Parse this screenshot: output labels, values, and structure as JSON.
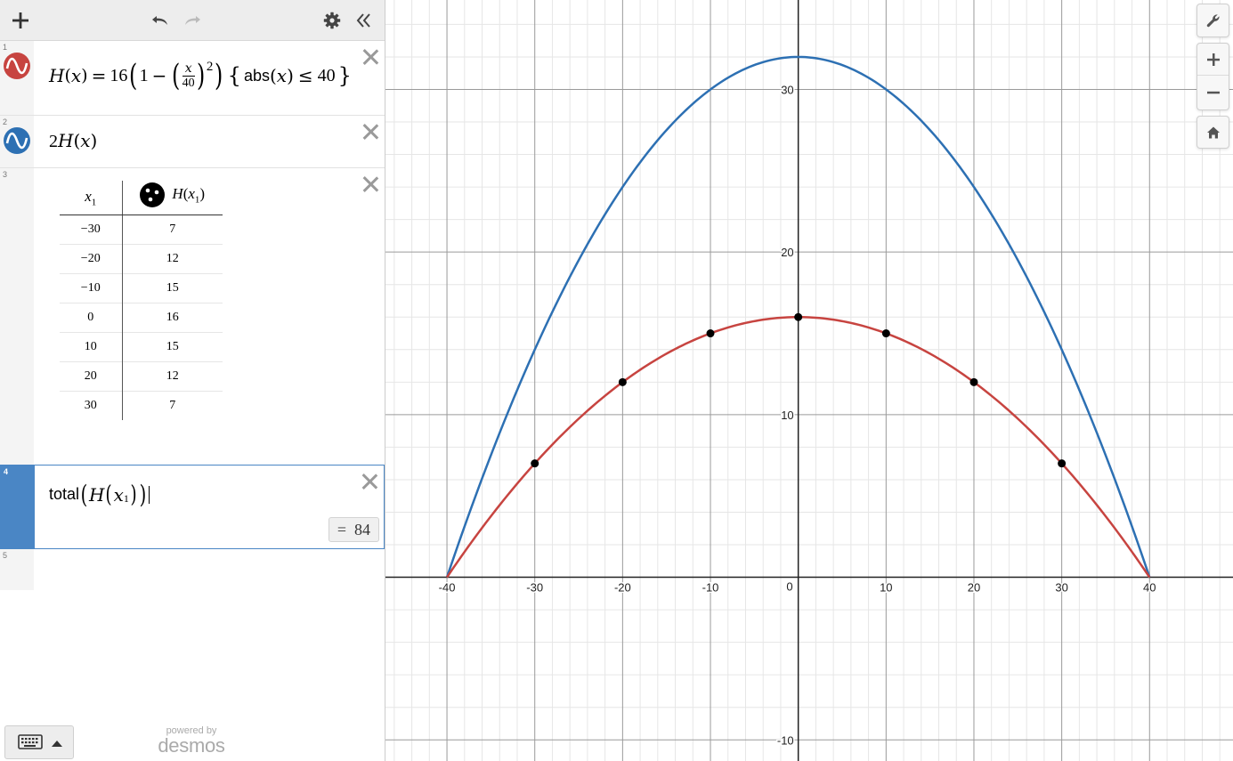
{
  "brand": {
    "powered_by": "powered by",
    "name": "desmos"
  },
  "colors": {
    "red": "#c74440",
    "blue": "#2d70b3",
    "selected": "#4a86c5"
  },
  "toolbar": {
    "add_icon": "plus-icon",
    "undo_icon": "undo-icon",
    "redo_icon": "redo-icon",
    "settings_icon": "gear-icon",
    "collapse_icon": "double-chevron-left-icon"
  },
  "expressions": [
    {
      "number": "1",
      "color": "#c74440",
      "latex": "H(x)=16\\left(1-\\left(\\frac{x}{40}\\right)^2\\right)\\left\\{abs(x)\\le 40\\right\\}",
      "parts": {
        "fn": "H",
        "var": "x",
        "coef": "16",
        "one": "1",
        "frac_num": "x",
        "frac_den": "40",
        "exp": "2",
        "abs": "abs",
        "bound": "40"
      }
    },
    {
      "number": "2",
      "color": "#2d70b3",
      "latex": "2H(x)",
      "parts": {
        "coef": "2",
        "fn": "H",
        "var": "x"
      }
    },
    {
      "number": "3",
      "type": "table",
      "headers": {
        "col1_var": "x",
        "col1_sub": "1",
        "col2_fn": "H",
        "col2_var": "x",
        "col2_sub": "1"
      },
      "rows": [
        [
          "−30",
          "7"
        ],
        [
          "−20",
          "12"
        ],
        [
          "−10",
          "15"
        ],
        [
          "0",
          "16"
        ],
        [
          "10",
          "15"
        ],
        [
          "20",
          "12"
        ],
        [
          "30",
          "7"
        ]
      ]
    },
    {
      "number": "4",
      "latex": "total\\left(H\\left(x_1\\right)\\right)",
      "parts": {
        "fn": "total",
        "inner_fn": "H",
        "var": "x",
        "sub": "1"
      },
      "result_eq": "=",
      "result": "84"
    },
    {
      "number": "5",
      "latex": ""
    }
  ],
  "graph": {
    "x_ticks": [
      "-40",
      "-30",
      "-20",
      "-10",
      "0",
      "10",
      "20",
      "30",
      "40"
    ],
    "y_ticks": [
      "-10",
      "10",
      "20",
      "30"
    ],
    "xlim": [
      -47,
      49.5
    ],
    "ylim": [
      -11.3,
      35.5
    ],
    "controls": {
      "settings_icon": "wrench-icon",
      "zoom_in_icon": "plus-icon",
      "zoom_out_icon": "minus-icon",
      "home_icon": "home-icon"
    }
  },
  "chart_data": {
    "type": "line",
    "series": [
      {
        "expression": "H(x)",
        "color": "#c74440",
        "formula": "16(1-(x/40)^2) for |x|<=40"
      },
      {
        "expression": "2H(x)",
        "color": "#2d70b3",
        "formula": "32(1-(x/40)^2) for |x|<=40"
      }
    ],
    "points": {
      "x": [
        -30,
        -20,
        -10,
        0,
        10,
        20,
        30
      ],
      "y": [
        7,
        12,
        15,
        16,
        15,
        12,
        7
      ],
      "color": "#000000"
    },
    "xlim": [
      -47,
      49.5
    ],
    "ylim": [
      -11.3,
      35.5
    ],
    "x_ticks": [
      -40,
      -30,
      -20,
      -10,
      0,
      10,
      20,
      30,
      40
    ],
    "y_ticks": [
      -10,
      10,
      20,
      30
    ],
    "grid": true,
    "minor_grid_step": 2,
    "major_grid_step": 10
  },
  "keyboard": {
    "icon": "keyboard-icon",
    "toggle_icon": "caret-up-icon"
  }
}
